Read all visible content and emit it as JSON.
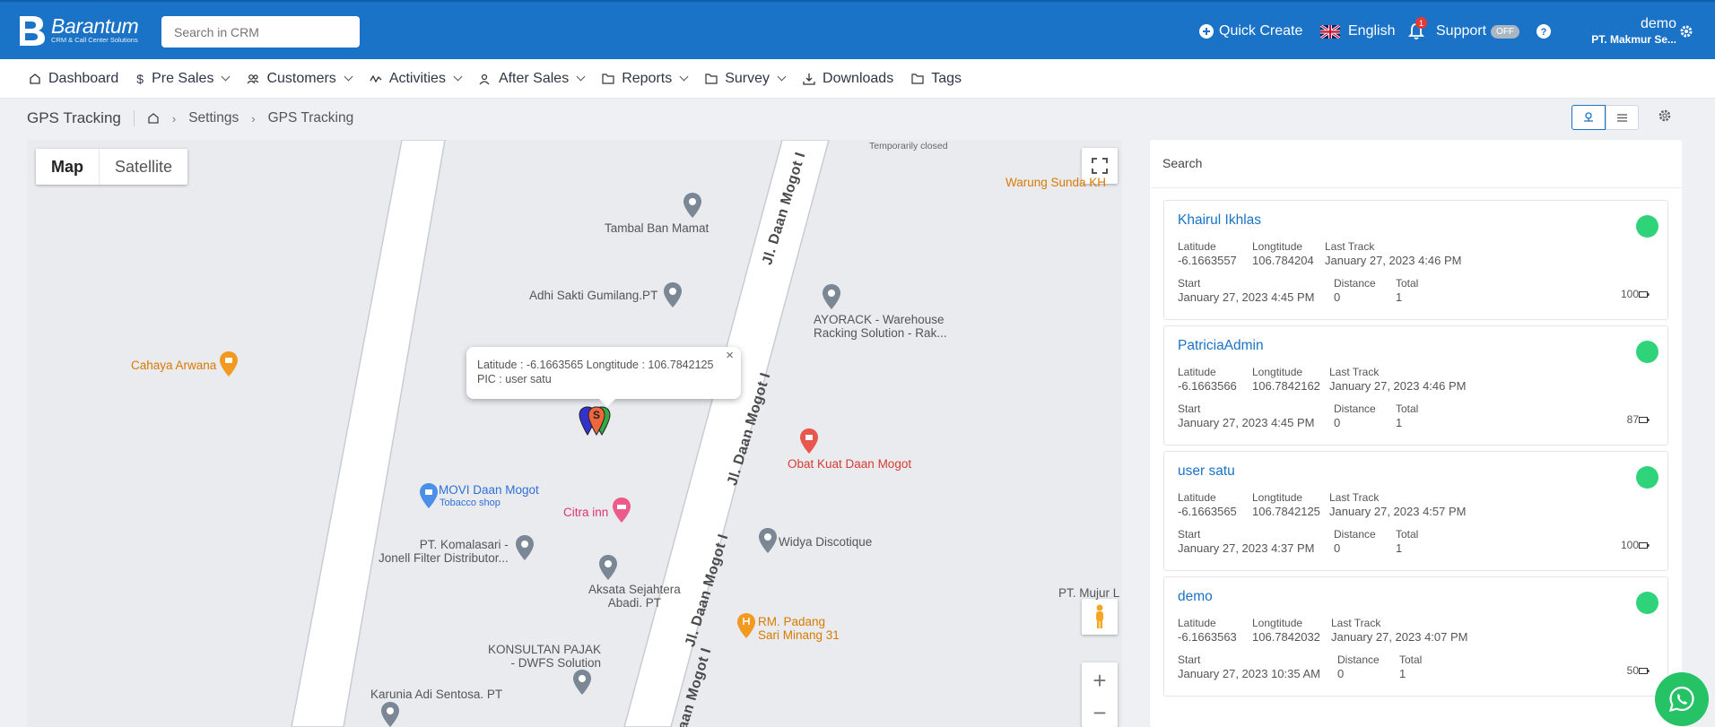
{
  "header": {
    "brand": "Barantum",
    "tagline": "CRM & Call Center Solutions",
    "search_placeholder": "Search in CRM",
    "quick_create": "Quick Create",
    "language": "English",
    "notification_count": "1",
    "support": "Support",
    "support_toggle": "OFF",
    "user_name": "demo",
    "company": "PT. Makmur Se..."
  },
  "nav": {
    "items": [
      {
        "label": "Dashboard",
        "icon": "home-icon"
      },
      {
        "label": "Pre Sales",
        "icon": "dollar-icon"
      },
      {
        "label": "Customers",
        "icon": "users-icon"
      },
      {
        "label": "Activities",
        "icon": "activity-icon"
      },
      {
        "label": "After Sales",
        "icon": "user-icon"
      },
      {
        "label": "Reports",
        "icon": "folder-icon"
      },
      {
        "label": "Survey",
        "icon": "folder-icon"
      },
      {
        "label": "Downloads",
        "icon": "download-icon"
      },
      {
        "label": "Tags",
        "icon": "folder-icon"
      }
    ]
  },
  "breadcrumb": {
    "title": "GPS Tracking",
    "level1": "Settings",
    "level2": "GPS Tracking"
  },
  "map": {
    "type_map": "Map",
    "type_satellite": "Satellite",
    "places": {
      "temporarily_closed": "Temporarily closed",
      "warung": "Warung Sunda KH",
      "tambal": "Tambal Ban Mamat",
      "adhi": "Adhi Sakti Gumilang.PT",
      "ayorack": "AYORACK - Warehouse\nRacking Solution - Rak...",
      "cahaya": "Cahaya Arwana",
      "obat": "Obat Kuat Daan Mogot",
      "movi": "MOVI Daan Mogot",
      "movi_sub": "Tobacco shop",
      "citra": "Citra inn",
      "komalasari": "PT. Komalasari -\nJonell Filter Distributor...",
      "widya": "Widya Discotique",
      "aksata": "Aksata Sejahtera\nAbadi. PT",
      "rm_padang": "RM. Padang\nSari Minang 31",
      "mujur": "PT. Mujur L",
      "konsultan": "KONSULTAN PAJAK\n- DWFS Solution",
      "karunia": "Karunia Adi Sentosa. PT"
    },
    "roads": {
      "road1": "Jl. Daan Mogot I",
      "road2": "Jl. Daan Mogot I",
      "road3": "Jl. Daan Mogot I",
      "road4": "Jl. Daan Mogot I"
    },
    "popup": {
      "line1": "Latitude : -6.1663565 Longtitude : 106.7842125",
      "line2": "PIC : user satu"
    },
    "marker_letter": "S"
  },
  "panel": {
    "search_label": "Search",
    "labels": {
      "latitude": "Latitude",
      "longtitude": "Longtitude",
      "last_track": "Last Track",
      "start": "Start",
      "distance": "Distance",
      "total": "Total"
    },
    "users": [
      {
        "name": "Khairul Ikhlas",
        "lat": "-6.1663557",
        "lng": "106.784204",
        "last": "January 27, 2023 4:46 PM",
        "start": "January 27, 2023 4:45 PM",
        "distance": "0",
        "total": "1",
        "battery": "100"
      },
      {
        "name": "PatriciaAdmin",
        "lat": "-6.1663566",
        "lng": "106.7842162",
        "last": "January 27, 2023 4:46 PM",
        "start": "January 27, 2023 4:45 PM",
        "distance": "0",
        "total": "1",
        "battery": "87"
      },
      {
        "name": "user satu",
        "lat": "-6.1663565",
        "lng": "106.7842125",
        "last": "January 27, 2023 4:57 PM",
        "start": "January 27, 2023 4:37 PM",
        "distance": "0",
        "total": "1",
        "battery": "100"
      },
      {
        "name": "demo",
        "lat": "-6.1663563",
        "lng": "106.7842032",
        "last": "January 27, 2023 4:07 PM",
        "start": "January 27, 2023 10:35 AM",
        "distance": "0",
        "total": "1",
        "battery": "50"
      }
    ]
  },
  "colors": {
    "header_blue": "#1a73c6",
    "online_green": "#2fd47a",
    "whatsapp": "#25c266"
  }
}
